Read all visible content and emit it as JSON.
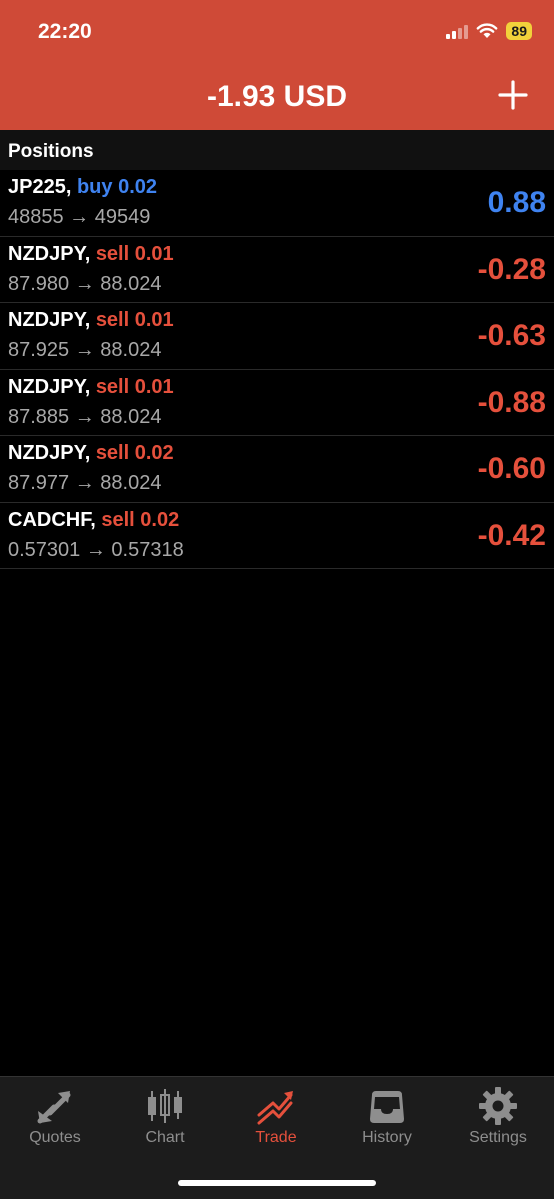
{
  "status_bar": {
    "time": "22:20",
    "battery": "89"
  },
  "header": {
    "balance": "-1.93 USD",
    "add_icon": "plus-icon",
    "color": "#cf4a37"
  },
  "positions": {
    "title": "Positions",
    "rows": [
      {
        "symbol": "JP225,",
        "side": "buy 0.02",
        "side_type": "buy",
        "prices": "48855 → 49549",
        "profit": "0.88",
        "profit_sign": "pos"
      },
      {
        "symbol": "NZDJPY,",
        "side": "sell 0.01",
        "side_type": "sell",
        "prices": "87.980 → 88.024",
        "profit": "-0.28",
        "profit_sign": "neg"
      },
      {
        "symbol": "NZDJPY,",
        "side": "sell 0.01",
        "side_type": "sell",
        "prices": "87.925 → 88.024",
        "profit": "-0.63",
        "profit_sign": "neg"
      },
      {
        "symbol": "NZDJPY,",
        "side": "sell 0.01",
        "side_type": "sell",
        "prices": "87.885 → 88.024",
        "profit": "-0.88",
        "profit_sign": "neg"
      },
      {
        "symbol": "NZDJPY,",
        "side": "sell 0.02",
        "side_type": "sell",
        "prices": "87.977 → 88.024",
        "profit": "-0.60",
        "profit_sign": "neg"
      },
      {
        "symbol": "CADCHF,",
        "side": "sell 0.02",
        "side_type": "sell",
        "prices": "0.57301 → 0.57318",
        "profit": "-0.42",
        "profit_sign": "neg"
      }
    ]
  },
  "tabbar": {
    "tabs": [
      {
        "label": "Quotes",
        "icon": "quotes-icon",
        "active": false
      },
      {
        "label": "Chart",
        "icon": "candlestick-icon",
        "active": false
      },
      {
        "label": "Trade",
        "icon": "trade-icon",
        "active": true
      },
      {
        "label": "History",
        "icon": "inbox-icon",
        "active": false
      },
      {
        "label": "Settings",
        "icon": "gear-icon",
        "active": false
      }
    ]
  },
  "colors": {
    "buy": "#3f83f0",
    "sell": "#e5503c",
    "active_tab": "#e5503c"
  }
}
